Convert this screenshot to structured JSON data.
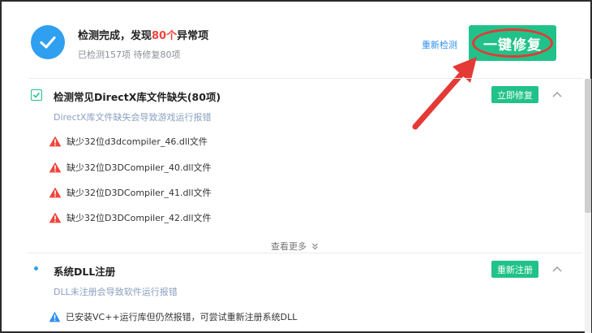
{
  "header": {
    "title_prefix": "检测完成，发现",
    "title_highlight": "80个",
    "title_suffix": "异常项",
    "summary": "已检测157项 待修复80项",
    "recheck_label": "重新检测",
    "fix_all_label": "一键修复"
  },
  "sections": [
    {
      "title": "检测常见DirectX库文件缺失(80项)",
      "description": "DirectX库文件缺失会导致游戏运行报错",
      "button_label": "立即修复",
      "items": [
        "缺少32位d3dcompiler_46.dll文件",
        "缺少32位D3DCompiler_40.dll文件",
        "缺少32位D3DCompiler_41.dll文件",
        "缺少32位D3DCompiler_42.dll文件"
      ],
      "more_label": "查看更多"
    },
    {
      "title": "系统DLL注册",
      "description": "DLL未注册会导致软件运行报错",
      "button_label": "重新注册",
      "items": [
        "已安装VC++运行库但仍然报错，可尝试重新注册系统DLL"
      ]
    }
  ],
  "colors": {
    "accent_green": "#21c28a",
    "accent_blue": "#2f9ff0",
    "highlight_red": "#f0453a",
    "annotation_red": "#e53935"
  },
  "icons": {
    "status": "check-circle-icon",
    "item_warning": "warning-triangle-icon",
    "info_warning": "warning-triangle-blue-icon",
    "collapse": "chevron-up-icon",
    "more": "double-chevron-down-icon"
  }
}
